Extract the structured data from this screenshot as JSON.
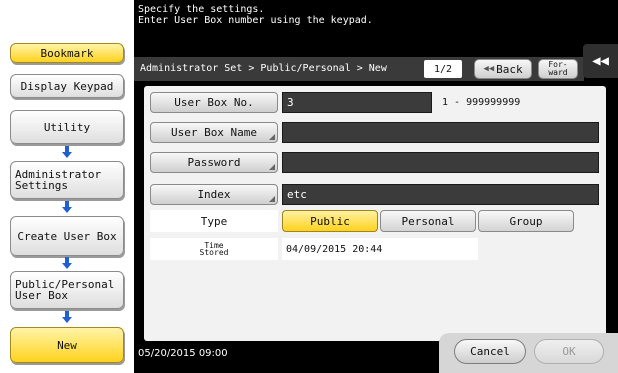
{
  "header": {
    "instruction_line1": "Specify the settings.",
    "instruction_line2": "Enter User Box number using the keypad."
  },
  "sidebar": {
    "bookmark": "Bookmark",
    "display_keypad": "Display Keypad",
    "flow": [
      {
        "label": "Utility"
      },
      {
        "label": "Administrator\nSettings"
      },
      {
        "label": "Create User Box"
      },
      {
        "label": "Public/Personal\nUser Box"
      },
      {
        "label": "New"
      }
    ]
  },
  "toolbar": {
    "breadcrumb": "Administrator Set > Public/Personal > New",
    "page_indicator": "1/2",
    "back_label": "Back",
    "forward_label": "For-\nward",
    "collapse_icon": "double-chevron-left-icon"
  },
  "form": {
    "user_box_no": {
      "label": "User Box No.",
      "value": "3",
      "range": "1 - 999999999"
    },
    "user_box_name": {
      "label": "User Box Name",
      "value": ""
    },
    "password": {
      "label": "Password",
      "value": ""
    },
    "index": {
      "label": "Index",
      "value": "etc"
    },
    "type": {
      "label": "Type",
      "options": [
        "Public",
        "Personal",
        "Group"
      ],
      "selected": "Public"
    },
    "time_stored": {
      "label_line1": "Time",
      "label_line2": "Stored",
      "value": "04/09/2015  20:44"
    }
  },
  "footer": {
    "datetime": "05/20/2015  09:00",
    "cancel_label": "Cancel",
    "ok_label": "OK"
  },
  "colors": {
    "accent_yellow": "#ffd21e",
    "panel_dark": "#000000",
    "field_dark": "#3b3b3b",
    "flow_arrow": "#1f5fd1"
  }
}
